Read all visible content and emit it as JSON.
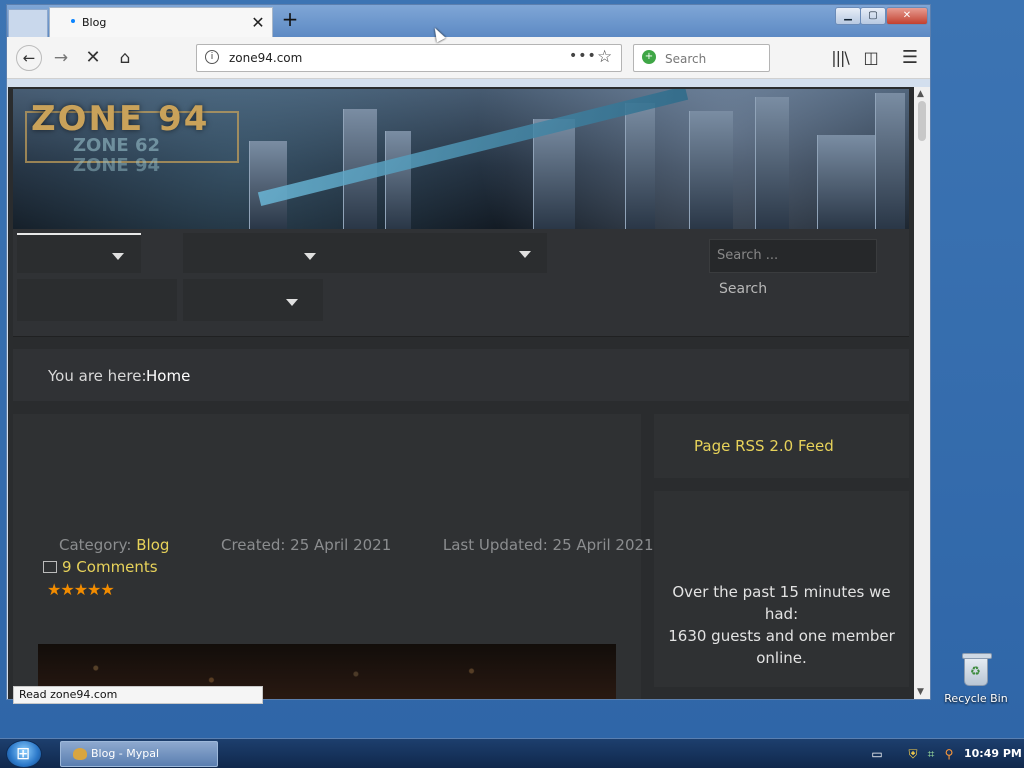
{
  "browser": {
    "tab_title": "Blog",
    "url": "zone94.com",
    "search_placeholder": "Search",
    "status_text": "Read zone94.com"
  },
  "site": {
    "logo_text": "ZONE 94",
    "logo_sub_1": "ZONE 62",
    "logo_sub_2": "ZONE 94",
    "search_placeholder": "Search ...",
    "search_button": "Search"
  },
  "breadcrumb": {
    "label": "You are here:",
    "current": "Home"
  },
  "article": {
    "category_label": "Category:",
    "category": "Blog",
    "created": "Created: 25 April 2021",
    "updated": "Last Updated: 25 April 2021",
    "comments": "9 Comments",
    "rating_stars": "★★★★★"
  },
  "sidebar": {
    "rss": "Page RSS 2.0 Feed",
    "stats_line1": "Over the past 15 minutes we had:",
    "stats_line2": "1630 guests and one member online."
  },
  "desktop": {
    "recycle_bin": "Recycle Bin"
  },
  "taskbar": {
    "window_label": "Blog - Mypal",
    "clock": "10:49 PM"
  },
  "icons": {
    "back": "back-arrow-icon",
    "forward": "forward-arrow-icon",
    "stop": "stop-icon",
    "home": "home-icon",
    "info": "info-icon",
    "more": "more-dots-icon",
    "bookmark": "star-icon",
    "library": "library-icon",
    "sidebar": "sidebar-icon",
    "menu": "hamburger-icon"
  },
  "colors": {
    "accent_link": "#e7d25a",
    "stars": "#f28c00",
    "page_bg": "#2a2c2e"
  }
}
